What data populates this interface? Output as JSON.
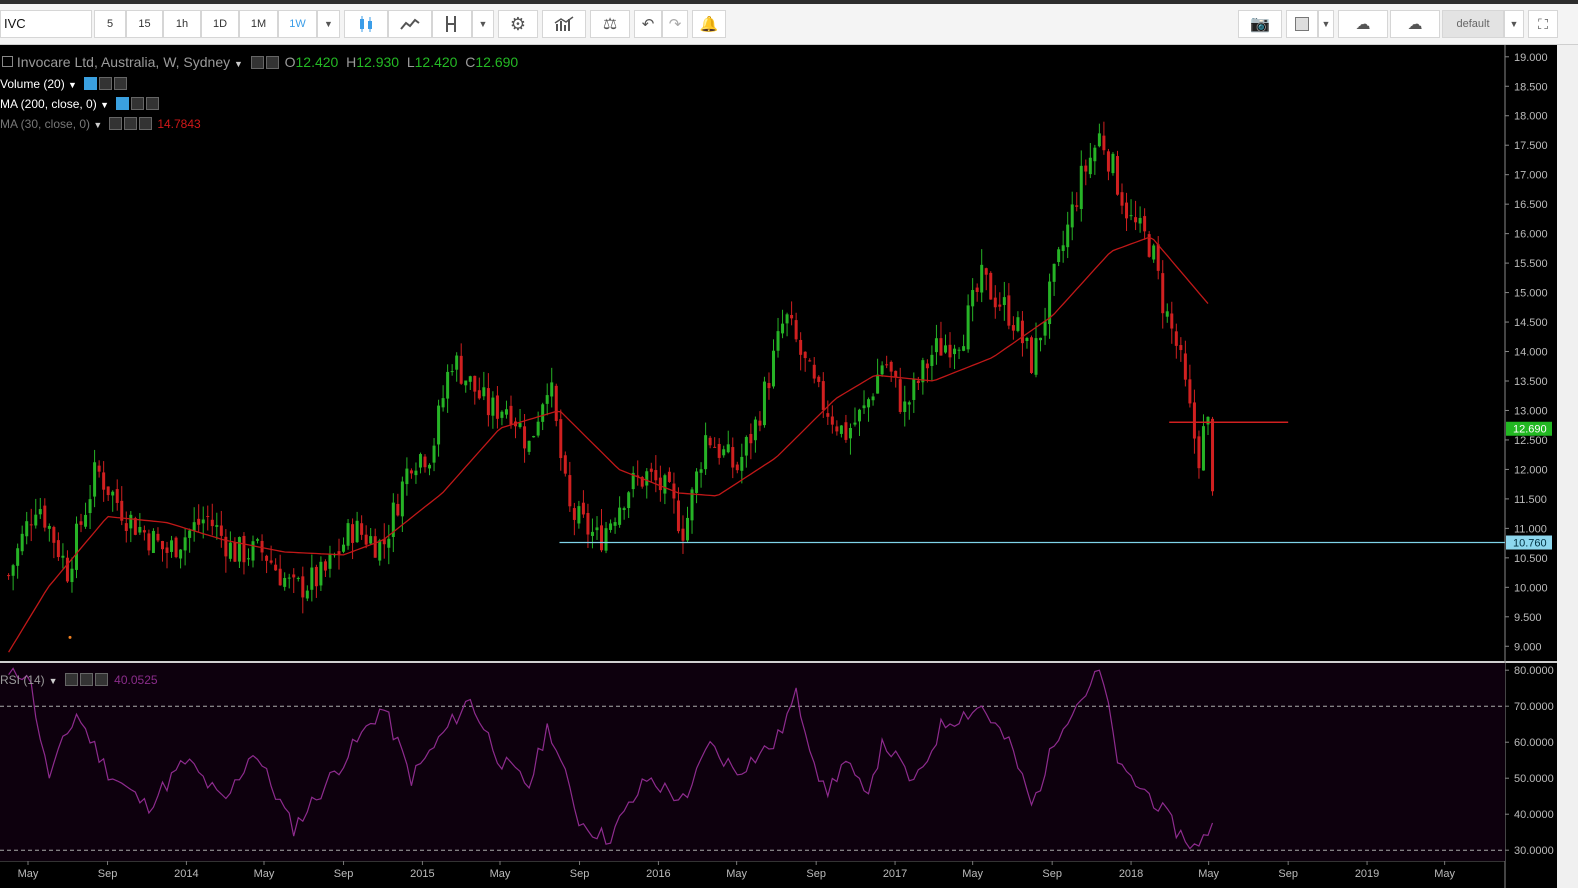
{
  "toolbar": {
    "symbol": "IVC",
    "intervals": [
      "5",
      "15",
      "1h",
      "1D",
      "1M",
      "1W"
    ],
    "active_interval": "1W",
    "layout_name": "default"
  },
  "legend": {
    "title": "Invocare Ltd, Australia, W, Sydney",
    "open_label": "O",
    "open": "12.420",
    "high_label": "H",
    "high": "12.930",
    "low_label": "L",
    "low": "12.420",
    "close_label": "C",
    "close": "12.690",
    "volume": "Volume (20)",
    "ma200": "MA (200, close, 0)",
    "ma30": "MA (30, close, 0)",
    "ma30_value": "14.7843",
    "rsi": "RSI (14)",
    "rsi_value": "40.0525"
  },
  "colors": {
    "up": "#26b326",
    "down": "#d02020",
    "ma30": "#c01818",
    "rsi": "#8e2b8e",
    "support": "#7fd3e8",
    "current_price_tag": "#22b822",
    "support_tag": "#8dd7ee"
  },
  "chart_data": [
    {
      "type": "candlestick",
      "title": "Invocare Ltd, Australia, W, Sydney",
      "ylim": [
        8.75,
        19.2
      ],
      "y_ticks": [
        "9.000",
        "9.500",
        "10.000",
        "10.500",
        "11.000",
        "11.500",
        "12.000",
        "12.500",
        "13.000",
        "13.500",
        "14.000",
        "14.500",
        "15.000",
        "15.500",
        "16.000",
        "16.500",
        "17.000",
        "17.500",
        "18.000",
        "18.500",
        "19.000"
      ],
      "x_ticks": [
        "May",
        "Sep",
        "2014",
        "May",
        "Sep",
        "2015",
        "May",
        "Sep",
        "2016",
        "May",
        "Sep",
        "2017",
        "May",
        "Sep",
        "2018",
        "May",
        "Sep",
        "2019",
        "May"
      ],
      "current_price": "12.690",
      "support_level": "10.760",
      "resistance_level": 12.8,
      "anchors": [
        [
          "2013-04-01",
          10.2
        ],
        [
          "2013-05-15",
          11.5
        ],
        [
          "2013-07-01",
          10.3
        ],
        [
          "2013-08-15",
          12.0
        ],
        [
          "2013-10-01",
          11.2
        ],
        [
          "2013-12-01",
          10.6
        ],
        [
          "2014-02-01",
          11.2
        ],
        [
          "2014-03-15",
          10.6
        ],
        [
          "2014-05-01",
          10.6
        ],
        [
          "2014-06-15",
          9.95
        ],
        [
          "2014-08-01",
          10.2
        ],
        [
          "2014-09-15",
          11.0
        ],
        [
          "2014-11-01",
          10.7
        ],
        [
          "2014-12-15",
          12.2
        ],
        [
          "2015-01-15",
          12.3
        ],
        [
          "2015-02-15",
          13.9
        ],
        [
          "2015-04-15",
          13.0
        ],
        [
          "2015-05-15",
          13.1
        ],
        [
          "2015-06-15",
          12.4
        ],
        [
          "2015-07-15",
          13.6
        ],
        [
          "2015-08-15",
          11.3
        ],
        [
          "2015-10-01",
          10.8
        ],
        [
          "2015-11-15",
          11.7
        ],
        [
          "2015-12-15",
          11.9
        ],
        [
          "2016-01-15",
          11.6
        ],
        [
          "2016-02-10",
          10.95
        ],
        [
          "2016-03-15",
          12.6
        ],
        [
          "2016-05-01",
          12.0
        ],
        [
          "2016-06-01",
          12.8
        ],
        [
          "2016-07-15",
          14.6
        ],
        [
          "2016-09-01",
          13.3
        ],
        [
          "2016-10-15",
          12.6
        ],
        [
          "2016-11-15",
          13.0
        ],
        [
          "2016-12-15",
          13.9
        ],
        [
          "2017-01-15",
          13.0
        ],
        [
          "2017-03-01",
          14.0
        ],
        [
          "2017-04-15",
          14.3
        ],
        [
          "2017-05-15",
          15.2
        ],
        [
          "2017-07-01",
          14.6
        ],
        [
          "2017-08-01",
          13.8
        ],
        [
          "2017-09-01",
          15.1
        ],
        [
          "2017-10-15",
          16.9
        ],
        [
          "2017-11-15",
          17.7
        ],
        [
          "2018-01-01",
          16.2
        ],
        [
          "2018-02-01",
          15.8
        ],
        [
          "2018-02-20",
          14.8
        ],
        [
          "2018-03-15",
          14.0
        ],
        [
          "2018-04-15",
          12.2
        ],
        [
          "2018-04-29",
          12.9
        ],
        [
          "2018-05-06",
          11.7
        ],
        [
          "2018-05-13",
          12.69
        ]
      ],
      "ma30": [
        [
          "2013-04-01",
          8.9
        ],
        [
          "2013-06-01",
          10.0
        ],
        [
          "2013-09-01",
          11.2
        ],
        [
          "2013-12-01",
          11.1
        ],
        [
          "2014-03-01",
          10.8
        ],
        [
          "2014-06-01",
          10.6
        ],
        [
          "2014-09-01",
          10.55
        ],
        [
          "2014-11-01",
          10.8
        ],
        [
          "2015-02-01",
          11.6
        ],
        [
          "2015-05-01",
          12.7
        ],
        [
          "2015-08-01",
          13.0
        ],
        [
          "2015-11-01",
          12.0
        ],
        [
          "2016-02-01",
          11.6
        ],
        [
          "2016-04-01",
          11.55
        ],
        [
          "2016-07-01",
          12.2
        ],
        [
          "2016-10-01",
          13.2
        ],
        [
          "2016-12-01",
          13.6
        ],
        [
          "2017-03-01",
          13.5
        ],
        [
          "2017-06-01",
          13.9
        ],
        [
          "2017-09-01",
          14.6
        ],
        [
          "2017-12-01",
          15.7
        ],
        [
          "2018-02-01",
          15.95
        ],
        [
          "2018-05-01",
          14.8
        ]
      ]
    },
    {
      "type": "line",
      "title": "RSI (14)",
      "ylim": [
        27,
        82
      ],
      "y_ticks": [
        "30.0000",
        "40.0000",
        "50.0000",
        "60.0000",
        "70.0000",
        "80.0000"
      ],
      "levels": [
        30,
        70
      ],
      "anchors": [
        [
          "2013-04-01",
          78
        ],
        [
          "2013-05-01",
          80
        ],
        [
          "2013-06-01",
          50
        ],
        [
          "2013-07-15",
          68
        ],
        [
          "2013-09-01",
          52
        ],
        [
          "2013-11-01",
          42
        ],
        [
          "2014-01-01",
          55
        ],
        [
          "2014-03-01",
          43
        ],
        [
          "2014-04-15",
          58
        ],
        [
          "2014-06-15",
          36
        ],
        [
          "2014-09-01",
          55
        ],
        [
          "2014-11-01",
          70
        ],
        [
          "2014-12-15",
          50
        ],
        [
          "2015-02-01",
          62
        ],
        [
          "2015-03-15",
          72
        ],
        [
          "2015-05-01",
          55
        ],
        [
          "2015-06-15",
          48
        ],
        [
          "2015-07-15",
          65
        ],
        [
          "2015-09-01",
          38
        ],
        [
          "2015-10-15",
          33
        ],
        [
          "2015-12-15",
          50
        ],
        [
          "2016-02-15",
          43
        ],
        [
          "2016-03-15",
          60
        ],
        [
          "2016-05-01",
          52
        ],
        [
          "2016-07-01",
          60
        ],
        [
          "2016-08-01",
          73
        ],
        [
          "2016-09-15",
          45
        ],
        [
          "2016-10-15",
          55
        ],
        [
          "2016-11-15",
          45
        ],
        [
          "2016-12-15",
          60
        ],
        [
          "2017-02-01",
          48
        ],
        [
          "2017-03-15",
          65
        ],
        [
          "2017-05-15",
          70
        ],
        [
          "2017-07-01",
          58
        ],
        [
          "2017-08-01",
          42
        ],
        [
          "2017-09-15",
          65
        ],
        [
          "2017-10-15",
          72
        ],
        [
          "2017-11-15",
          80
        ],
        [
          "2017-12-15",
          52
        ],
        [
          "2018-02-01",
          45
        ],
        [
          "2018-03-15",
          35
        ],
        [
          "2018-04-15",
          30
        ],
        [
          "2018-05-01",
          36
        ],
        [
          "2018-05-13",
          40
        ]
      ]
    }
  ]
}
